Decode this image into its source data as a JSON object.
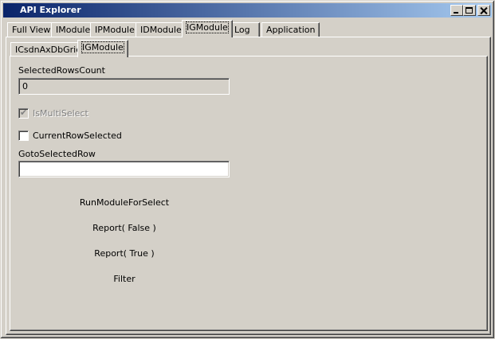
{
  "window": {
    "title": "API Explorer"
  },
  "main_tabs": [
    {
      "label": "Full View"
    },
    {
      "label": "IModule"
    },
    {
      "label": "IPModule"
    },
    {
      "label": "IDModule"
    },
    {
      "label": "IGModule"
    },
    {
      "label": "Log"
    },
    {
      "label": "Application"
    }
  ],
  "main_tab_active": "IGModule",
  "sub_tabs": [
    {
      "label": "ICsdnAxDbGrid"
    },
    {
      "label": "IGModule"
    }
  ],
  "sub_tab_active": "IGModule",
  "form": {
    "selected_rows_count_label": "SelectedRowsCount",
    "selected_rows_count_value": "0",
    "is_multi_select_label": "IsMultiSelect",
    "is_multi_select_checked": true,
    "current_row_selected_label": "CurrentRowSelected",
    "current_row_selected_checked": false,
    "goto_selected_row_label": "GotoSelectedRow",
    "goto_selected_row_value": ""
  },
  "actions": {
    "run_module_for_select": "RunModuleForSelect",
    "report_false": "Report( False )",
    "report_true": "Report( True )",
    "filter": "Filter"
  }
}
